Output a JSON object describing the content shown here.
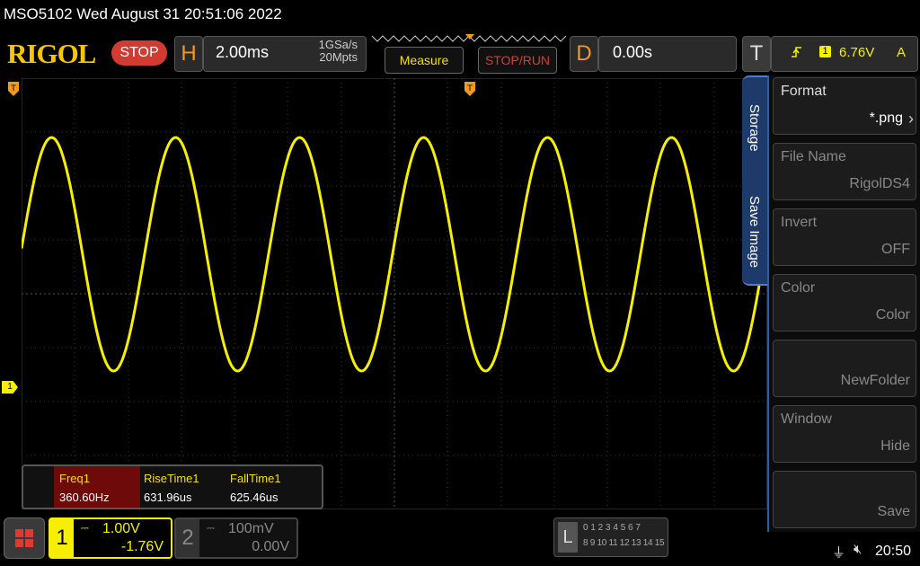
{
  "title_bar": {
    "text": "MSO5102  Wed August 31 20:51:06 2022"
  },
  "logo": "RIGOL",
  "run_state": "STOP",
  "horizontal": {
    "letter": "H",
    "timebase": "2.00ms",
    "sample_rate": "1GSa/s",
    "memory_depth": "20Mpts"
  },
  "buttons": {
    "measure": "Measure",
    "stop_run": "STOP/RUN"
  },
  "delay": {
    "letter": "D",
    "value": "0.00s"
  },
  "trigger": {
    "letter": "T",
    "channel": "1",
    "level": "6.76V",
    "coupling": "A"
  },
  "channel1_marker": "1",
  "side_tabs": {
    "storage": "Storage",
    "save_image": "Save Image"
  },
  "menu": [
    {
      "label": "Format",
      "value": "*.png"
    },
    {
      "label": "File Name",
      "value": "RigolDS4"
    },
    {
      "label": "Invert",
      "value": "OFF"
    },
    {
      "label": "Color",
      "value": "Color"
    },
    {
      "label": "",
      "value": "NewFolder"
    },
    {
      "label": "Window",
      "value": "Hide"
    },
    {
      "label": "",
      "value": "Save"
    }
  ],
  "measurements": {
    "headers": [
      "Freq1",
      "RiseTime1",
      "FallTime1"
    ],
    "values": [
      "360.60Hz",
      "631.96us",
      "625.46us"
    ]
  },
  "ch1": {
    "number": "1",
    "scale": "1.00V",
    "offset": "-1.76V"
  },
  "ch2": {
    "number": "2",
    "scale": "100mV",
    "offset": "0.00V"
  },
  "logic": {
    "letter": "L",
    "row1": "0 1 2 3  4 5 6 7",
    "row2": "8 9 10 11 12 13 14 15"
  },
  "status": {
    "time": "20:50"
  },
  "colors": {
    "ch1": "#f6f000",
    "accent_orange": "#f39a1c",
    "stop_red": "#d23b32",
    "menu_blue": "#1e3a6a"
  }
}
